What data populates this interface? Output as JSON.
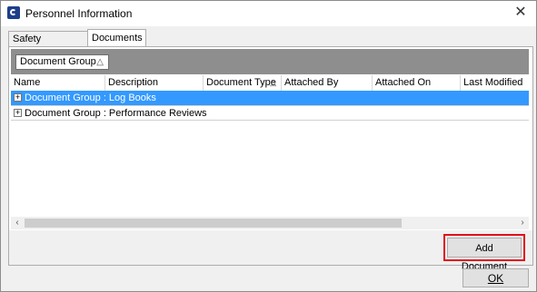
{
  "window": {
    "title": "Personnel Information",
    "close_glyph": "✕",
    "app_icon": "app-icon"
  },
  "tabs": [
    {
      "label": "Safety Information",
      "active": false
    },
    {
      "label": "Documents",
      "active": true
    }
  ],
  "group_panel": {
    "chip_label": "Document Group",
    "sort_glyph": "△"
  },
  "grid": {
    "columns": [
      {
        "label": "Name"
      },
      {
        "label": "Description"
      },
      {
        "label": "Document Type",
        "sort_glyph": "△"
      },
      {
        "label": "Attached By"
      },
      {
        "label": "Attached On"
      },
      {
        "label": "Last Modified"
      }
    ],
    "groups": [
      {
        "label": "Document Group : Log Books",
        "selected": true,
        "expander": "+"
      },
      {
        "label": "Document Group : Performance Reviews",
        "selected": false,
        "expander": "+"
      }
    ]
  },
  "scrollbar": {
    "left_glyph": "‹",
    "right_glyph": "›"
  },
  "buttons": {
    "add_document": "Add Document",
    "ok": "OK"
  },
  "colors": {
    "selection": "#3399ff",
    "group_panel": "#8e8e8e",
    "highlight_outline": "#e0101a"
  }
}
